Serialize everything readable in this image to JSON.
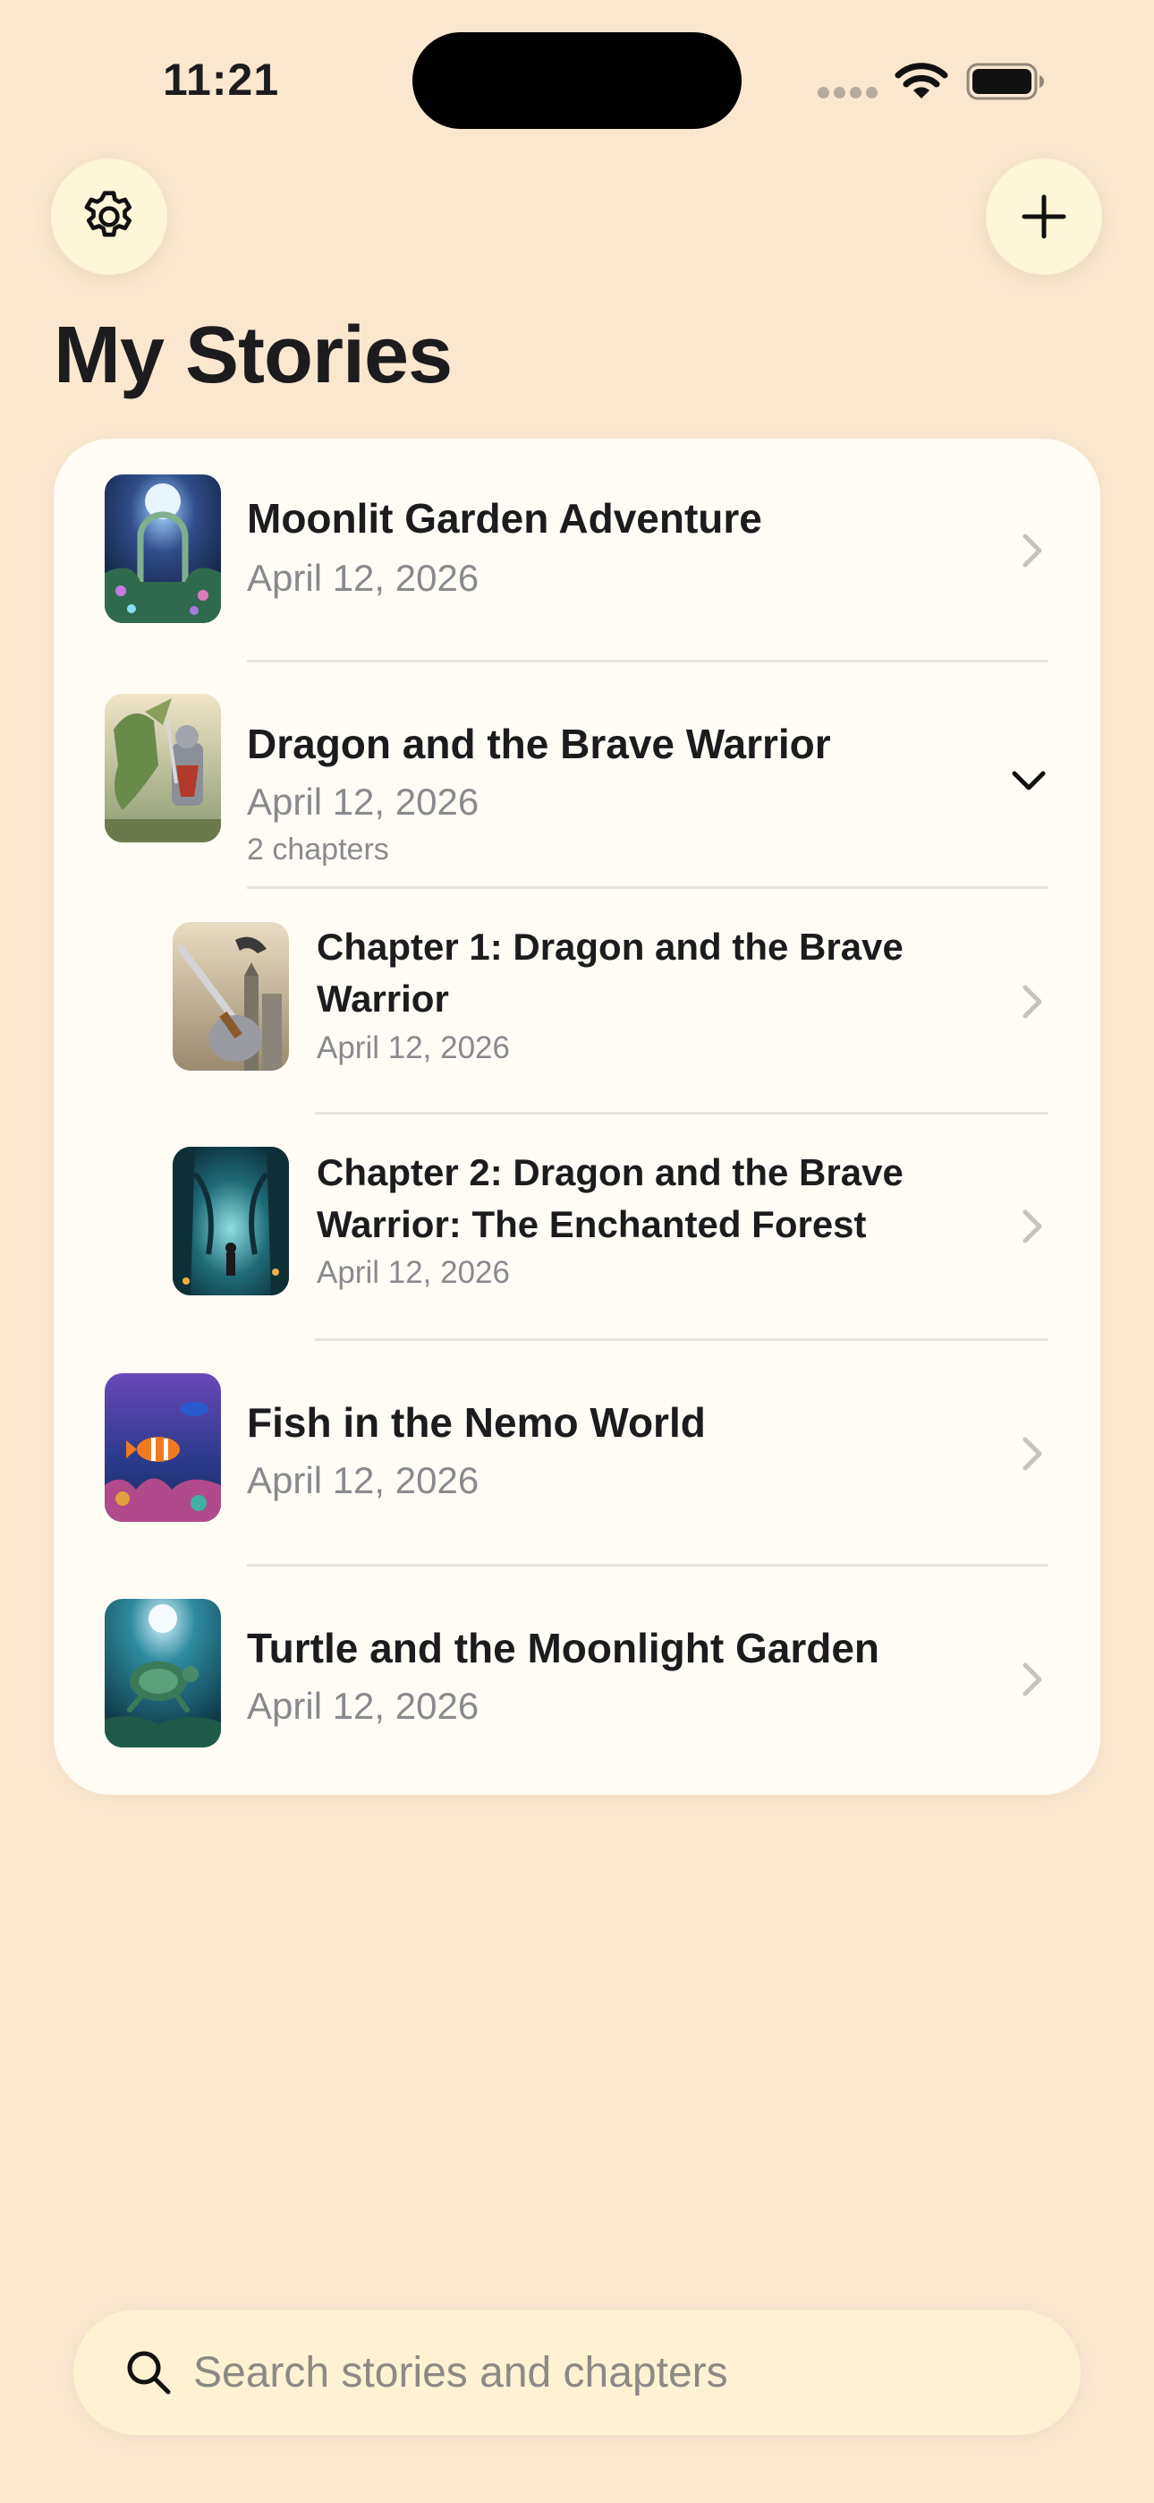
{
  "status_bar": {
    "time": "11:21",
    "icons": [
      "cellular-dots-icon",
      "wifi-icon",
      "battery-icon"
    ]
  },
  "header": {
    "settings_icon": "gear-icon",
    "add_icon": "plus-icon",
    "title": "My Stories"
  },
  "stories": [
    {
      "title": "Moonlit Garden Adventure",
      "date": "April 12, 2026",
      "thumbnail": "moonlit-garden-thumbnail",
      "indicator": "chevron-right-icon"
    },
    {
      "title": "Dragon and the Brave Warrior",
      "date": "April 12, 2026",
      "chapters_count": "2 chapters",
      "thumbnail": "dragon-warrior-thumbnail",
      "indicator": "chevron-down-icon",
      "expanded": true,
      "chapters": [
        {
          "title": "Chapter 1: Dragon and the Brave Warrior",
          "date": "April 12, 2026",
          "thumbnail": "sword-castle-thumbnail",
          "indicator": "chevron-right-icon"
        },
        {
          "title": "Chapter 2: Dragon and the Brave Warrior: The Enchanted Forest",
          "date": "April 12, 2026",
          "thumbnail": "enchanted-forest-thumbnail",
          "indicator": "chevron-right-icon"
        }
      ]
    },
    {
      "title": "Fish in the Nemo World",
      "date": "April 12, 2026",
      "thumbnail": "nemo-world-thumbnail",
      "indicator": "chevron-right-icon"
    },
    {
      "title": "Turtle and the Moonlight Garden",
      "date": "April 12, 2026",
      "thumbnail": "turtle-moonlight-thumbnail",
      "indicator": "chevron-right-icon"
    }
  ],
  "search": {
    "placeholder": "Search stories and chapters",
    "value": "",
    "icon": "search-icon"
  },
  "colors": {
    "background": "#f9e7d0",
    "card": "#fffcf6",
    "button": "#fdf6d8",
    "search_background": "#fdf2d2",
    "primary_text": "#1c1c1e",
    "secondary_text": "#8a8a8e"
  }
}
